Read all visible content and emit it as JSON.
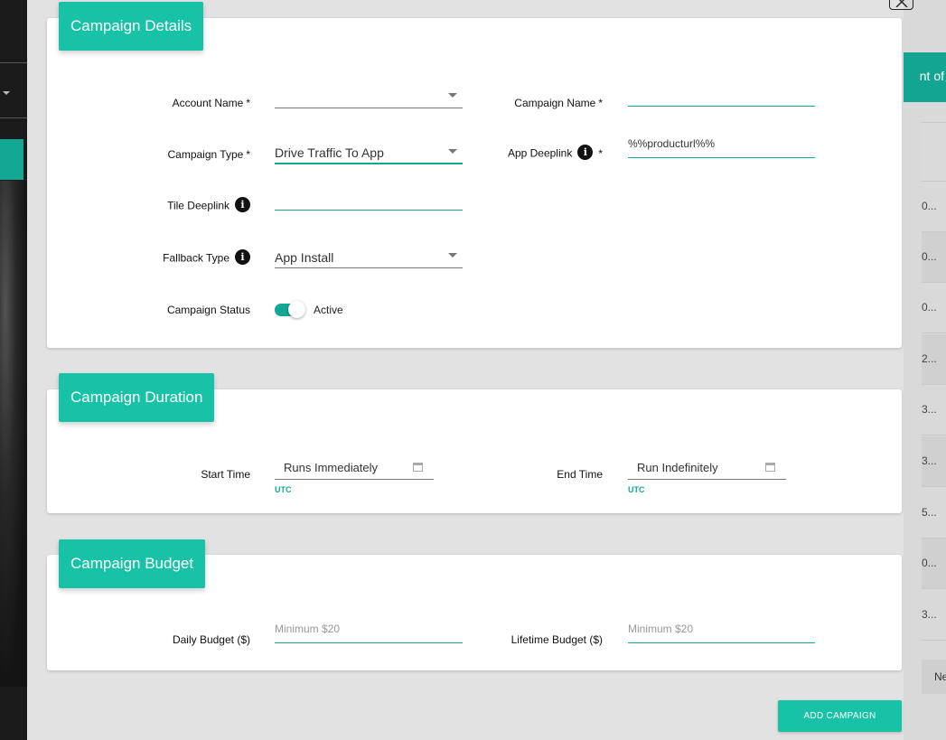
{
  "background": {
    "right_header_text": "nt of",
    "right_cells": [
      "0...",
      "0...",
      "0...",
      "2...",
      "3...",
      "3...",
      "5...",
      "0...",
      "3..."
    ],
    "pager_text": "Ne"
  },
  "details": {
    "title": "Campaign Details",
    "account_name_label": "Account Name",
    "account_name_value": "",
    "campaign_name_label": "Campaign Name",
    "campaign_name_value": "",
    "campaign_type_label": "Campaign Type",
    "campaign_type_value": "Drive Traffic To App",
    "app_deeplink_label": "App Deeplink",
    "app_deeplink_value": "%%producturl%%",
    "tile_deeplink_label": "Tile Deeplink",
    "tile_deeplink_value": "",
    "fallback_type_label": "Fallback Type",
    "fallback_type_value": "App Install",
    "campaign_status_label": "Campaign Status",
    "campaign_status_value": "Active",
    "required_mark": "*",
    "info_glyph": "i"
  },
  "duration": {
    "title": "Campaign Duration",
    "start_time_label": "Start Time",
    "start_time_value": "Runs Immediately",
    "end_time_label": "End Time",
    "end_time_value": "Run Indefinitely",
    "timezone": "UTC"
  },
  "budget": {
    "title": "Campaign Budget",
    "daily_label": "Daily Budget ($)",
    "daily_placeholder": "Minimum $20",
    "lifetime_label": "Lifetime Budget ($)",
    "lifetime_placeholder": "Minimum $20"
  },
  "actions": {
    "add_campaign": "ADD CAMPAIGN"
  },
  "colors": {
    "accent": "#18c2a6",
    "accent_dark": "#12a894"
  },
  "icons": {
    "close": "close-icon",
    "info": "info-icon",
    "dropdown": "chevron-down-icon",
    "calendar": "calendar-icon"
  }
}
